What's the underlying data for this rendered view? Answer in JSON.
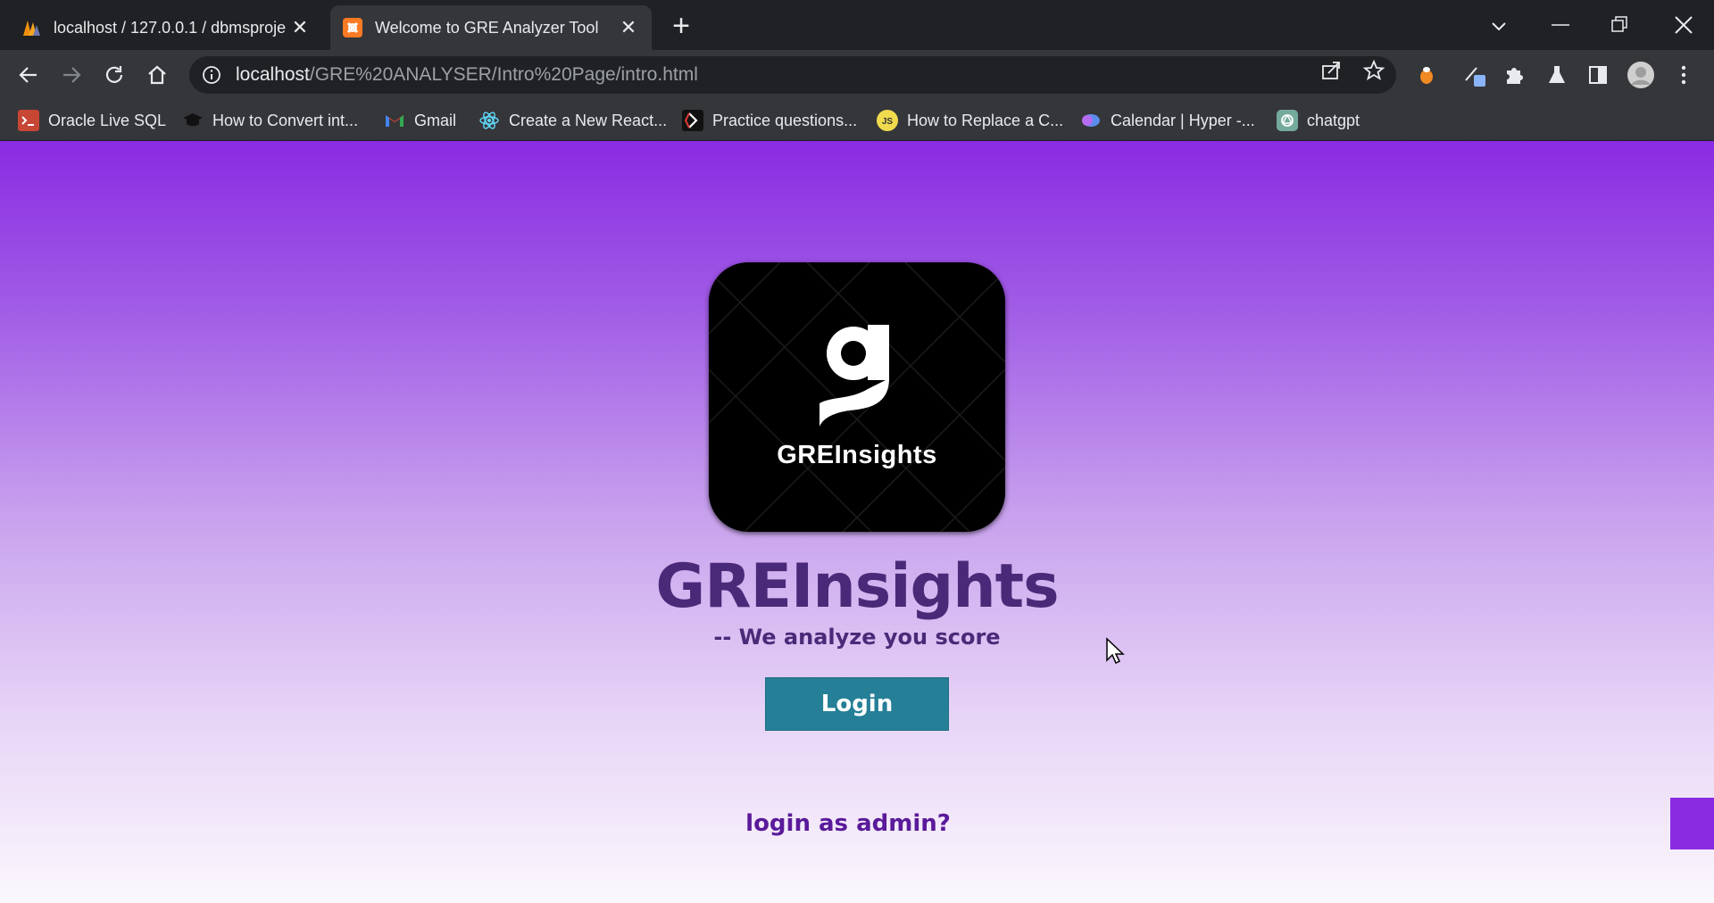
{
  "browser": {
    "tabs": [
      {
        "title": "localhost / 127.0.0.1 / dbmsproje",
        "favicon": "phpmyadmin-icon",
        "active": false
      },
      {
        "title": "Welcome to GRE Analyzer Tool",
        "favicon": "xampp-icon",
        "active": true
      }
    ],
    "close_glyph": "✕",
    "new_tab_glyph": "+",
    "url_host": "localhost",
    "url_path": "/GRE%20ANALYSER/Intro%20Page/intro.html",
    "bookmarks": [
      {
        "label": "Oracle Live SQL",
        "icon": "oracle-live-sql-icon",
        "color": "#c74634"
      },
      {
        "label": "How to Convert int...",
        "icon": "graduation-cap-icon",
        "color": "#000000"
      },
      {
        "label": "Gmail",
        "icon": "gmail-icon",
        "color": "#ea4335"
      },
      {
        "label": "Create a New React...",
        "icon": "react-icon",
        "color": "#61dafb"
      },
      {
        "label": "Practice questions...",
        "icon": "practice-icon",
        "color": "#ffffff"
      },
      {
        "label": "How to Replace a C...",
        "icon": "js-icon",
        "color": "#f0db4f",
        "icon_text": "JS"
      },
      {
        "label": "Calendar | Hyper -...",
        "icon": "calendar-hyper-icon",
        "color": "#5b8def"
      },
      {
        "label": "chatgpt",
        "icon": "chatgpt-icon",
        "color": "#ffffff"
      }
    ]
  },
  "page": {
    "logo_text": "GREInsights",
    "title": "GREInsights",
    "tagline": "--  We analyze you score",
    "login_label": "Login",
    "admin_link": "login as admin?"
  },
  "colors": {
    "accent": "#8a2be2",
    "title": "#4a2a78",
    "button": "#257f97",
    "admin_link": "#5a1a9a"
  }
}
